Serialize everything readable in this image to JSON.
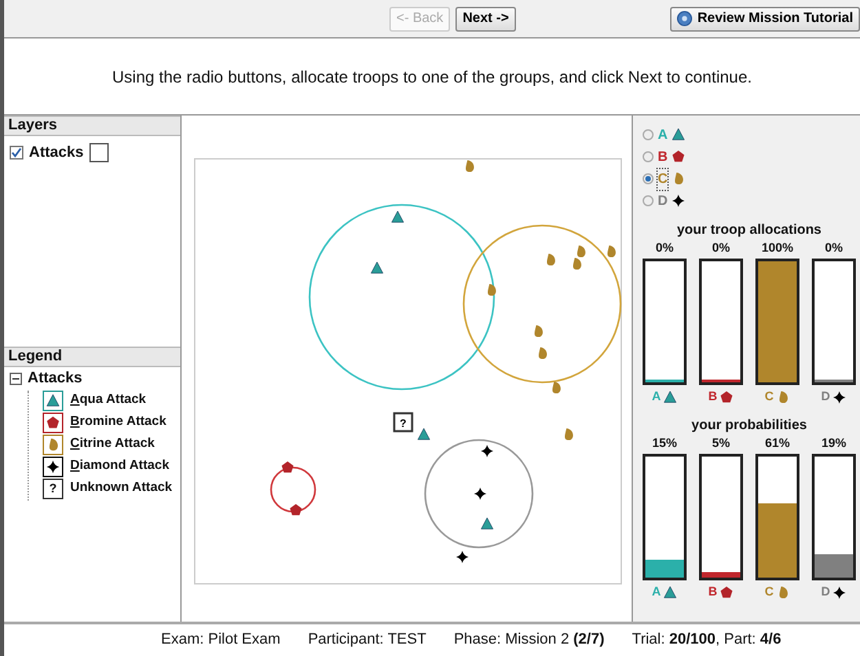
{
  "toolbar": {
    "buttons": [
      {
        "label": "<- Back",
        "disabled": true
      },
      {
        "label": "Next ->",
        "disabled": false
      }
    ],
    "tutorial_button": "Review Mission Tutorial"
  },
  "instruction": "Using the radio buttons, allocate troops to one of the groups, and click Next to continue.",
  "layers": {
    "title": "Layers",
    "items": [
      {
        "label": "Attacks",
        "checked": true
      }
    ]
  },
  "legend": {
    "title": "Legend",
    "tree": [
      {
        "label": "Attacks",
        "expanded": true,
        "children": [
          {
            "label": "Aqua Attack",
            "kind": "triangle",
            "color": "#2a9d98",
            "mnemonic": true
          },
          {
            "label": "Bromine Attack",
            "kind": "pentagon",
            "color": "#b3242a",
            "mnemonic": true
          },
          {
            "label": "Citrine Attack",
            "kind": "blob",
            "color": "#b0862c",
            "mnemonic": true
          },
          {
            "label": "Diamond Attack",
            "kind": "diamond",
            "color": "#111111",
            "mnemonic": true
          },
          {
            "label": "Unknown Attack",
            "kind": "unknown",
            "symbol": "?",
            "mnemonic": false
          }
        ]
      }
    ]
  },
  "map": {
    "unknown_marker": "?"
  },
  "groups": [
    {
      "letter": "A",
      "kind": "triangle",
      "color": "#2bb0aa",
      "selected": false
    },
    {
      "letter": "B",
      "kind": "pentagon",
      "color": "#c0272d",
      "selected": false
    },
    {
      "letter": "C",
      "kind": "blob",
      "color": "#b0862c",
      "selected": true
    },
    {
      "letter": "D",
      "kind": "diamond",
      "color": "#808080",
      "selected": false
    }
  ],
  "allocations": {
    "title": "your troop allocations",
    "bars": [
      {
        "value": "0%",
        "level": 0,
        "letter": "A"
      },
      {
        "value": "0%",
        "level": 0,
        "letter": "B"
      },
      {
        "value": "100%",
        "level": 1,
        "letter": "C"
      },
      {
        "value": "0%",
        "level": 0,
        "letter": "D"
      }
    ]
  },
  "probabilities": {
    "title": "your probabilities",
    "bars": [
      {
        "value": "15%",
        "level": 0.15,
        "letter": "A"
      },
      {
        "value": "5%",
        "level": 0.05,
        "letter": "B"
      },
      {
        "value": "61%",
        "level": 0.61,
        "letter": "C"
      },
      {
        "value": "19%",
        "level": 0.19,
        "letter": "D"
      }
    ]
  },
  "status": [
    "Exam: Pilot Exam",
    "Participant: TEST",
    "Phase: Mission 2 **(2/7)**",
    "Trial: **20/100**, Part: **4/6**"
  ]
}
